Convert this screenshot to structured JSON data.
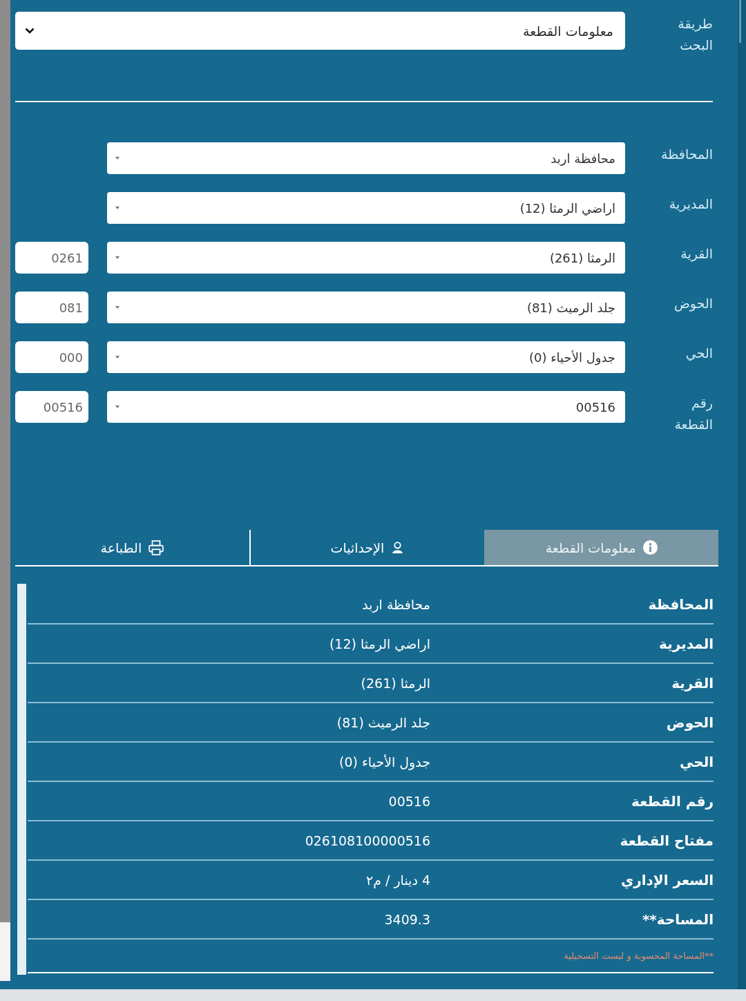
{
  "search_method": {
    "label": "طريقة البحث",
    "value": "معلومات القطعة"
  },
  "fields": [
    {
      "label": "المحافظة",
      "value": "محافظة اربد"
    },
    {
      "label": "المديرية",
      "value": "اراضي الرمثا (12)"
    },
    {
      "label": "القرية",
      "value": "الرمثا (261)",
      "code": "0261"
    },
    {
      "label": "الحوض",
      "value": "جلد الرميث (81)",
      "code": "081"
    },
    {
      "label": "الحي",
      "value": "جدول الأحياء (0)",
      "code": "000"
    },
    {
      "label": "رقم القطعة",
      "value": "00516",
      "code": "00516"
    }
  ],
  "tabs": [
    {
      "label": "معلومات القطعة",
      "selected": true
    },
    {
      "label": "الإحداثيات",
      "selected": false
    },
    {
      "label": "الطباعة",
      "selected": false
    }
  ],
  "details": [
    {
      "label": "المحافظة",
      "value": "محافظة اربد"
    },
    {
      "label": "المديرية",
      "value": "اراضي الرمثا (12)"
    },
    {
      "label": "القرية",
      "value": "الرمثا (261)"
    },
    {
      "label": "الحوض",
      "value": "جلد الرميث (81)"
    },
    {
      "label": "الحي",
      "value": "جدول الأحياء (0)"
    },
    {
      "label": "رقم القطعة",
      "value": "00516"
    },
    {
      "label": "مفتاح القطعة",
      "value": "026108100000516"
    },
    {
      "label": "السعر الإداري",
      "value": "4 دينار / م٢"
    },
    {
      "label": "المساحة**",
      "value": "3409.3"
    }
  ],
  "footnote": "**المساحة المحسوبة و ليست التسجيلية"
}
